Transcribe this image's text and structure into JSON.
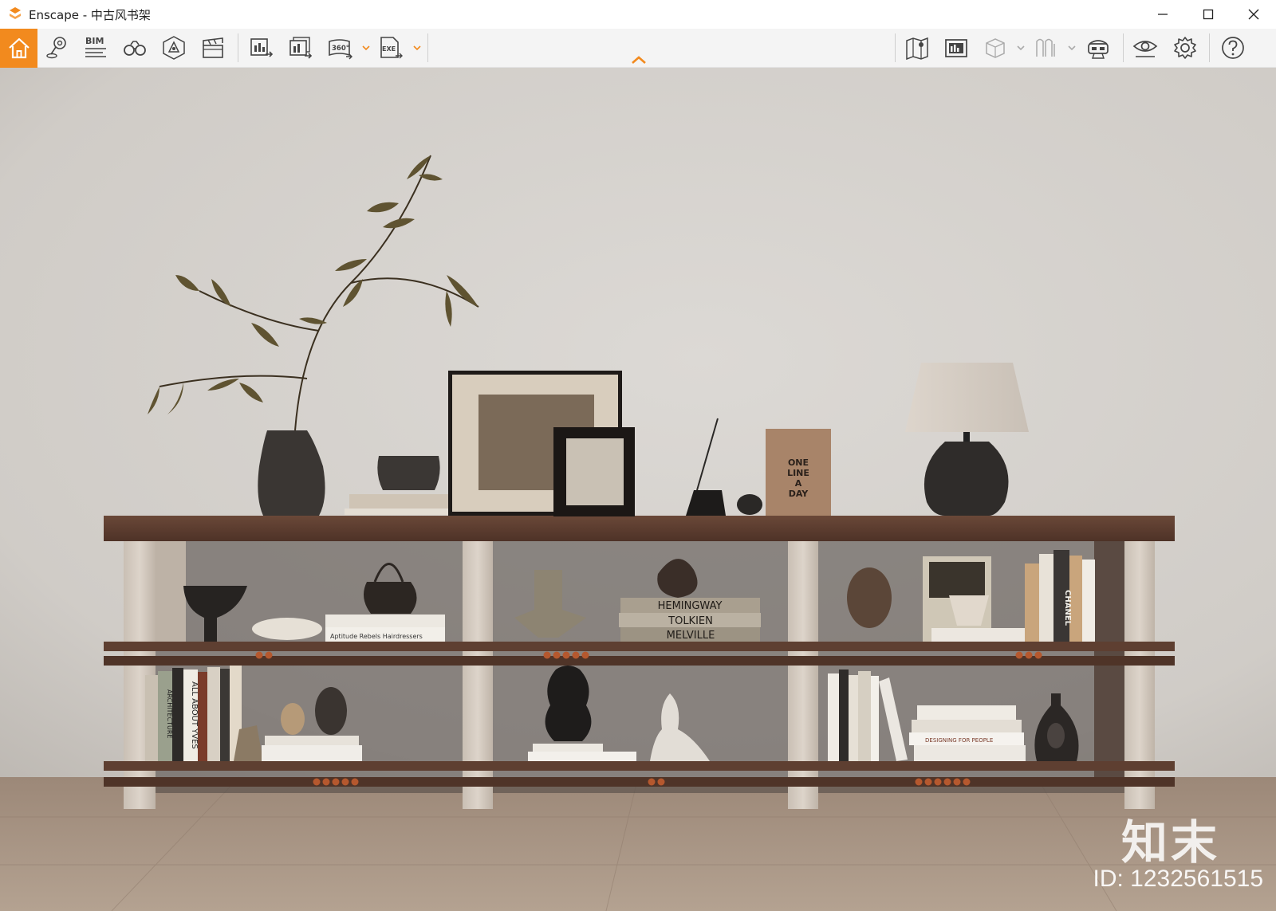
{
  "window": {
    "app_name": "Enscape",
    "title": "Enscape - 中古风书架",
    "accent_color": "#f28a1e"
  },
  "toolbar": {
    "left_icons": [
      "home-icon",
      "map-pin-icon",
      "bim-icon",
      "binoculars-icon",
      "asset-library-icon",
      "clapperboard-icon",
      "export-image-icon",
      "batch-render-icon",
      "panorama-360-icon",
      "export-exe-icon"
    ],
    "bim_label": "BIM",
    "panorama_label": "360°",
    "exe_label": "EXE",
    "right_icons": [
      "minimap-icon",
      "gallery-icon",
      "cube-view-icon",
      "light-view-icon",
      "vr-headset-icon",
      "visual-settings-icon",
      "settings-icon",
      "help-icon"
    ]
  },
  "scene": {
    "books": {
      "hemingway": "HEMINGWAY",
      "tolkien": "TOLKIEN",
      "melville": "MELVILLE",
      "one_line_a_day": [
        "ONE",
        "LINE",
        "A",
        "DAY"
      ],
      "chanel": "CHANEL",
      "architecture": "ARCHITECTURE",
      "all_about_yves": "ALL ABOUT YVES",
      "designing_for_people": "DESIGNING FOR PEOPLE",
      "aptitude": "Aptitude Rebels Hairdressers"
    }
  },
  "overlay": {
    "brand": "知末",
    "id_text": "ID: 1232561515"
  }
}
